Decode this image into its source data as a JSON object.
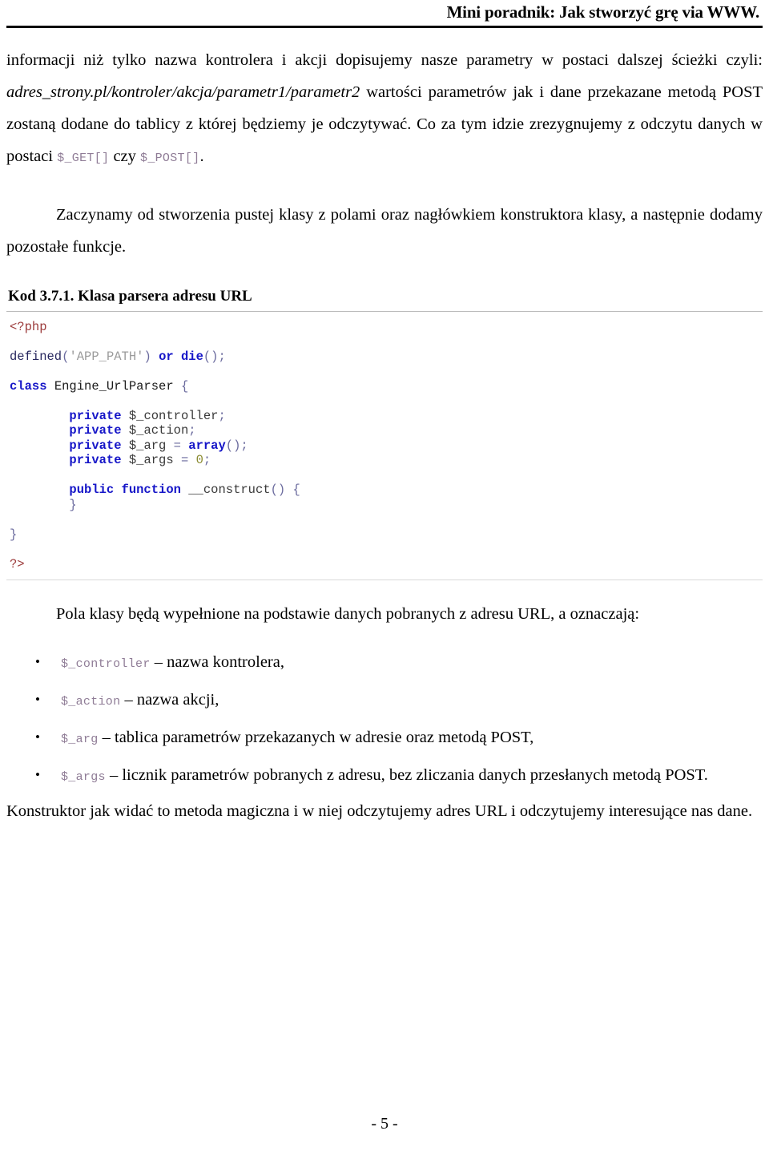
{
  "header": {
    "running_title": "Mini poradnik: Jak stworzyć grę via WWW."
  },
  "body": {
    "para1_a": "informacji niż tylko nazwa kontrolera i akcji dopisujemy nasze parametry w postaci dalszej ścieżki czyli: ",
    "para1_italic": "adres_strony.pl/kontroler/akcja/parametr1/parametr2",
    "para1_b": " wartości parametrów jak i dane przekazane metodą POST zostaną dodane do tablicy z której będziemy je odczytywać. Co za tym idzie zrezygnujemy z odczytu danych w postaci ",
    "para1_code1": "$_GET[]",
    "para1_c": " czy ",
    "para1_code2": "$_POST[]",
    "para1_d": ".",
    "para2": "Zaczynamy od stworzenia pustej klasy z polami oraz nagłówkiem konstruktora klasy, a następnie dodamy pozostałe funkcje.",
    "para3": "Pola klasy będą wypełnione na podstawie danych pobranych z adresu URL, a oznaczają:",
    "para4": "Konstruktor jak widać to metoda magiczna i w niej odczytujemy adres URL i odczytujemy interesujące nas dane."
  },
  "code_listing": {
    "caption": "Kod 3.7.1. Klasa parsera adresu URL",
    "lines": [
      {
        "tokens": [
          {
            "t": "<?php",
            "c": "c-php"
          }
        ]
      },
      {
        "tokens": []
      },
      {
        "tokens": [
          {
            "t": "defined",
            "c": "c-fn"
          },
          {
            "t": "(",
            "c": "c-punct"
          },
          {
            "t": "'APP_PATH'",
            "c": "c-str"
          },
          {
            "t": ") ",
            "c": "c-punct"
          },
          {
            "t": "or die",
            "c": "c-kw"
          },
          {
            "t": "();",
            "c": "c-punct"
          }
        ]
      },
      {
        "tokens": []
      },
      {
        "tokens": [
          {
            "t": "class",
            "c": "c-kw"
          },
          {
            "t": " Engine_UrlParser ",
            "c": "c-plain"
          },
          {
            "t": "{",
            "c": "c-punct"
          }
        ]
      },
      {
        "tokens": []
      },
      {
        "tokens": [
          {
            "t": "        ",
            "c": "c-plain"
          },
          {
            "t": "private",
            "c": "c-kw"
          },
          {
            "t": " $_controller",
            "c": "c-var"
          },
          {
            "t": ";",
            "c": "c-punct"
          }
        ]
      },
      {
        "tokens": [
          {
            "t": "        ",
            "c": "c-plain"
          },
          {
            "t": "private",
            "c": "c-kw"
          },
          {
            "t": " $_action",
            "c": "c-var"
          },
          {
            "t": ";",
            "c": "c-punct"
          }
        ]
      },
      {
        "tokens": [
          {
            "t": "        ",
            "c": "c-plain"
          },
          {
            "t": "private",
            "c": "c-kw"
          },
          {
            "t": " $_arg ",
            "c": "c-var"
          },
          {
            "t": "= ",
            "c": "c-punct"
          },
          {
            "t": "array",
            "c": "c-kw"
          },
          {
            "t": "();",
            "c": "c-punct"
          }
        ]
      },
      {
        "tokens": [
          {
            "t": "        ",
            "c": "c-plain"
          },
          {
            "t": "private",
            "c": "c-kw"
          },
          {
            "t": " $_args ",
            "c": "c-var"
          },
          {
            "t": "= ",
            "c": "c-punct"
          },
          {
            "t": "0",
            "c": "c-num"
          },
          {
            "t": ";",
            "c": "c-punct"
          }
        ]
      },
      {
        "tokens": []
      },
      {
        "tokens": [
          {
            "t": "        ",
            "c": "c-plain"
          },
          {
            "t": "public function",
            "c": "c-kw"
          },
          {
            "t": " __construct",
            "c": "c-var"
          },
          {
            "t": "() {",
            "c": "c-punct"
          }
        ]
      },
      {
        "tokens": [
          {
            "t": "        ",
            "c": "c-plain"
          },
          {
            "t": "}",
            "c": "c-punct"
          }
        ]
      },
      {
        "tokens": []
      },
      {
        "tokens": [
          {
            "t": "}",
            "c": "c-punct"
          }
        ]
      },
      {
        "tokens": []
      },
      {
        "tokens": [
          {
            "t": "?>",
            "c": "c-php"
          }
        ]
      }
    ]
  },
  "bullets": [
    {
      "code": "$_controller",
      "text": " – nazwa kontrolera,"
    },
    {
      "code": "$_action",
      "text": " – nazwa akcji,"
    },
    {
      "code": "$_arg",
      "text": " – tablica parametrów przekazanych w adresie oraz metodą POST,"
    },
    {
      "code": "$_args",
      "text": " – licznik parametrów pobranych z adresu, bez zliczania danych przesłanych metodą POST."
    }
  ],
  "footer": {
    "page_number": "- 5 -"
  }
}
